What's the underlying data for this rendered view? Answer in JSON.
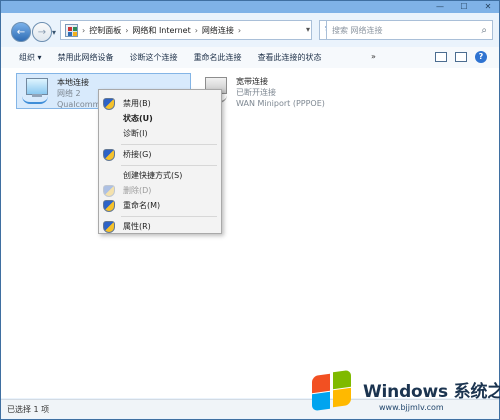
{
  "window": {
    "titlebar_controls": [
      "—",
      "☐",
      "✕"
    ]
  },
  "addressbar": {
    "crumbs": [
      "控制面板",
      "网络和 Internet",
      "网络连接"
    ],
    "search_placeholder": "搜索 网络连接"
  },
  "toolbar": {
    "items": [
      "组织 ▾",
      "禁用此网络设备",
      "诊断这个连接",
      "重命名此连接",
      "查看此连接的状态"
    ],
    "more": "»",
    "icons": [
      "view-options-icon",
      "preview-pane-icon",
      "help-icon"
    ]
  },
  "content": {
    "items": [
      {
        "name": "本地连接",
        "sub": "网络  2",
        "device": "Qualcomm",
        "selected": true
      },
      {
        "name": "宽带连接",
        "sub": "已断开连接",
        "device": "WAN Miniport (PPPOE)",
        "selected": false
      }
    ]
  },
  "context_menu": {
    "items": [
      {
        "label": "禁用(B)",
        "icon": "shield-icon",
        "bold": false,
        "disabled": false
      },
      {
        "label": "状态(U)",
        "icon": "",
        "bold": true,
        "disabled": false
      },
      {
        "label": "诊断(I)",
        "icon": "",
        "bold": false,
        "disabled": false
      },
      {
        "label": "桥接(G)",
        "icon": "shield-icon",
        "bold": false,
        "disabled": false
      },
      {
        "label": "创建快捷方式(S)",
        "icon": "",
        "bold": false,
        "disabled": false
      },
      {
        "label": "删除(D)",
        "icon": "shield-icon",
        "bold": false,
        "disabled": true
      },
      {
        "label": "重命名(M)",
        "icon": "shield-icon",
        "bold": false,
        "disabled": false
      },
      {
        "label": "属性(R)",
        "icon": "shield-icon",
        "bold": false,
        "disabled": false
      }
    ]
  },
  "statusbar": {
    "text": "已选择 1 项"
  },
  "watermark": {
    "brand": "Windows 系统之家",
    "url": "www.bjjmlv.com"
  }
}
